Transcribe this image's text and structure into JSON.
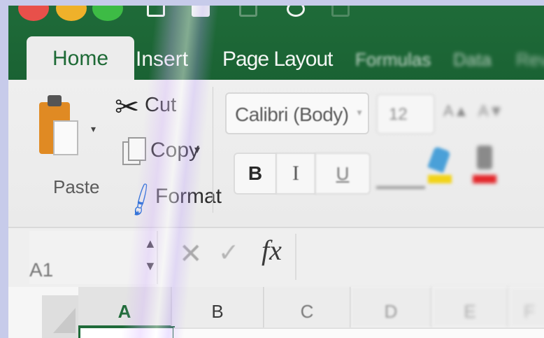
{
  "ribbon_tabs": {
    "home": "Home",
    "insert": "Insert",
    "page_layout": "Page Layout",
    "formulas": "Formulas",
    "data": "Data",
    "review": "Revi"
  },
  "clipboard": {
    "paste_label": "Paste",
    "cut_label": "Cut",
    "copy_label": "Copy",
    "format_label": "Format",
    "dropdown_glyph": "▾"
  },
  "font": {
    "font_name": "Calibri (Body)",
    "font_size": "12",
    "bold_label": "B",
    "italic_label": "I",
    "underline_label": "U"
  },
  "formula_bar": {
    "name_box_value": "A1",
    "fx_label": "fx",
    "cancel_glyph": "✕",
    "enter_glyph": "✓"
  },
  "columns": [
    "A",
    "B",
    "C",
    "D",
    "E",
    "F"
  ],
  "colors": {
    "excel_green": "#1f6b39",
    "paste_orange": "#e08a23",
    "fill_yellow": "#f2d318",
    "font_red": "#e3262a"
  },
  "icons": {
    "cut": "scissors-icon",
    "copy": "copy-icon",
    "format": "format-painter-icon",
    "paste": "clipboard-icon"
  }
}
